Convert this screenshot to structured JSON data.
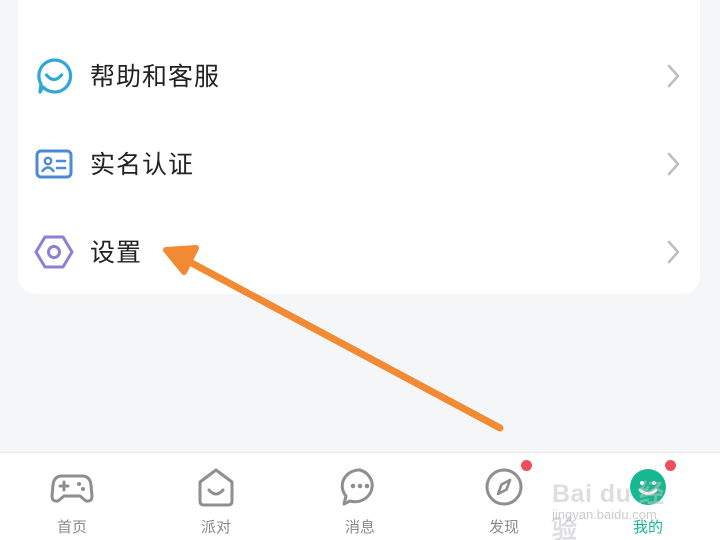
{
  "menu": {
    "items": [
      {
        "label": "帮助和客服",
        "icon": "headset-smile-icon"
      },
      {
        "label": "实名认证",
        "icon": "id-card-icon"
      },
      {
        "label": "设置",
        "icon": "hexagon-gear-icon"
      }
    ]
  },
  "tabbar": {
    "tabs": [
      {
        "label": "首页",
        "icon": "gamepad-icon",
        "badge": false
      },
      {
        "label": "派对",
        "icon": "home-smile-icon",
        "badge": false
      },
      {
        "label": "消息",
        "icon": "chat-bubble-icon",
        "badge": false
      },
      {
        "label": "发现",
        "icon": "compass-icon",
        "badge": true
      },
      {
        "label": "我的",
        "icon": "profile-icon",
        "badge": true,
        "active": true
      }
    ]
  },
  "watermark": {
    "text": "Bai du 经验",
    "sub": "jingyan.baidu.com"
  },
  "colors": {
    "accent": "#17b890",
    "annotation_arrow": "#f28a33",
    "badge": "#ef4f5c",
    "help_icon": "#2fa8d8",
    "idcard_icon": "#4a8ad6",
    "settings_icon": "#8d7fd6"
  }
}
